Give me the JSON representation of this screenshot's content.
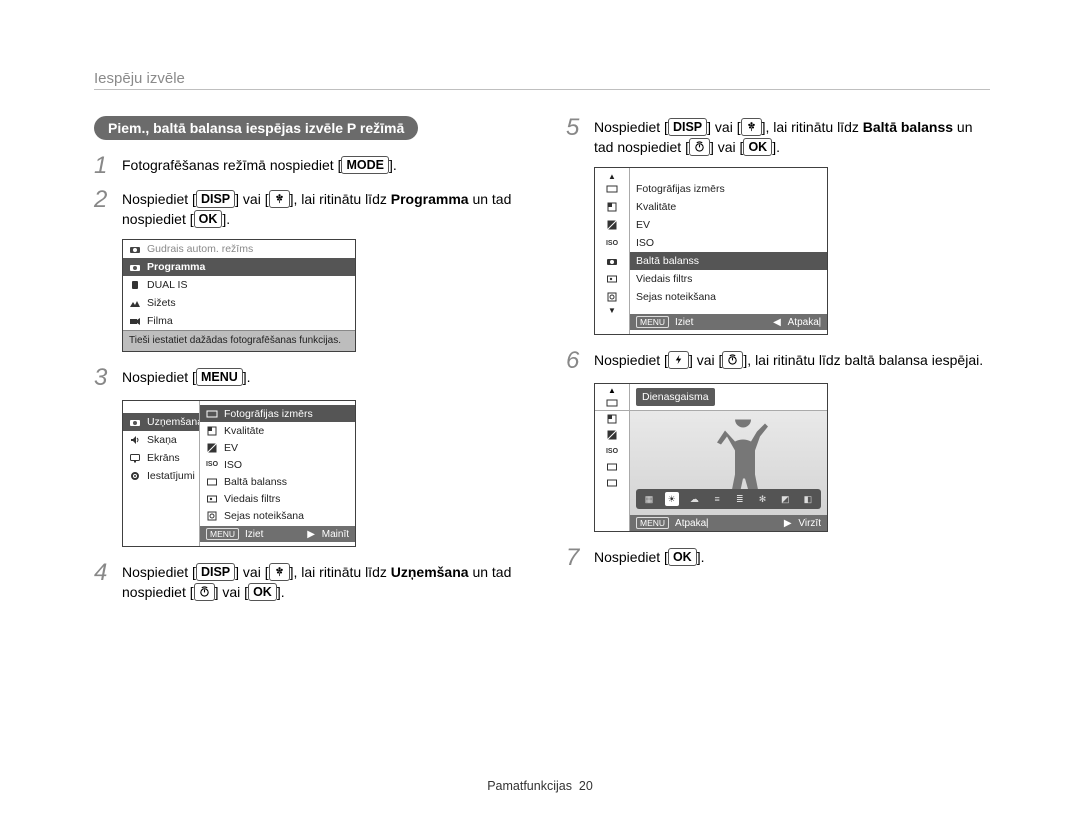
{
  "header": "Iespēju izvēle",
  "pill": "Piem., baltā balansa iespējas izvēle P režīmā",
  "btns": {
    "mode": "MODE",
    "disp": "DISP",
    "ok": "OK",
    "menu": "MENU"
  },
  "steps": {
    "s1": {
      "a": "Fotografēšanas režīmā nospiediet [",
      "b": "]."
    },
    "s2": {
      "a": "Nospiediet [",
      "b": "] vai [",
      "c": "], lai ritinātu līdz ",
      "prog": "Programma",
      "d": " un tad nospiediet [",
      "e": "]."
    },
    "s3": {
      "a": "Nospiediet [",
      "b": "]."
    },
    "s4": {
      "a": "Nospiediet [",
      "b": "] vai [",
      "c": "], lai ritinātu līdz ",
      "uzn": "Uzņemšana",
      "d": " un tad nospiediet [",
      "e": "] vai [",
      "f": "]."
    },
    "s5": {
      "a": "Nospiediet [",
      "b": "] vai [",
      "c": "], lai ritinātu līdz ",
      "bb": "Baltā balanss",
      "d": " un tad nospiediet [",
      "e": "] vai [",
      "f": "]."
    },
    "s6": {
      "a": "Nospiediet [",
      "b": "] vai [",
      "c": "], lai ritinātu līdz baltā balansa iespējai."
    },
    "s7": {
      "a": "Nospiediet [",
      "b": "]."
    }
  },
  "menu1": {
    "items": [
      "Gudrais autom. režīms",
      "Programma",
      "DUAL IS",
      "Sižets",
      "Filma"
    ],
    "desc": "Tieši iestatiet dažādas fotografēšanas funkcijas."
  },
  "menu2": {
    "left": [
      "Uzņemšana",
      "Skaņa",
      "Ekrāns",
      "Iestatījumi"
    ],
    "right": [
      "Fotogrāfijas izmērs",
      "Kvalitāte",
      "EV",
      "ISO",
      "Baltā balanss",
      "Viedais filtrs",
      "Sejas noteikšana"
    ],
    "bar": {
      "exit": "Iziet",
      "exitKey": "MENU",
      "change": "Mainīt",
      "changeGlyph": "▶"
    }
  },
  "menuR": {
    "right": [
      "Fotogrāfijas izmērs",
      "Kvalitāte",
      "EV",
      "ISO",
      "Baltā balanss",
      "Viedais filtrs",
      "Sejas noteikšana"
    ],
    "bar": {
      "exit": "Iziet",
      "exitKey": "MENU",
      "back": "Atpakaļ",
      "backGlyph": "◀"
    }
  },
  "wb": {
    "label": "Dienasgaisma",
    "bar": {
      "back": "Atpakaļ",
      "backKey": "MENU",
      "move": "Virzīt",
      "moveGlyph": "▶"
    }
  },
  "footer": {
    "section": "Pamatfunkcijas",
    "page": "20"
  }
}
